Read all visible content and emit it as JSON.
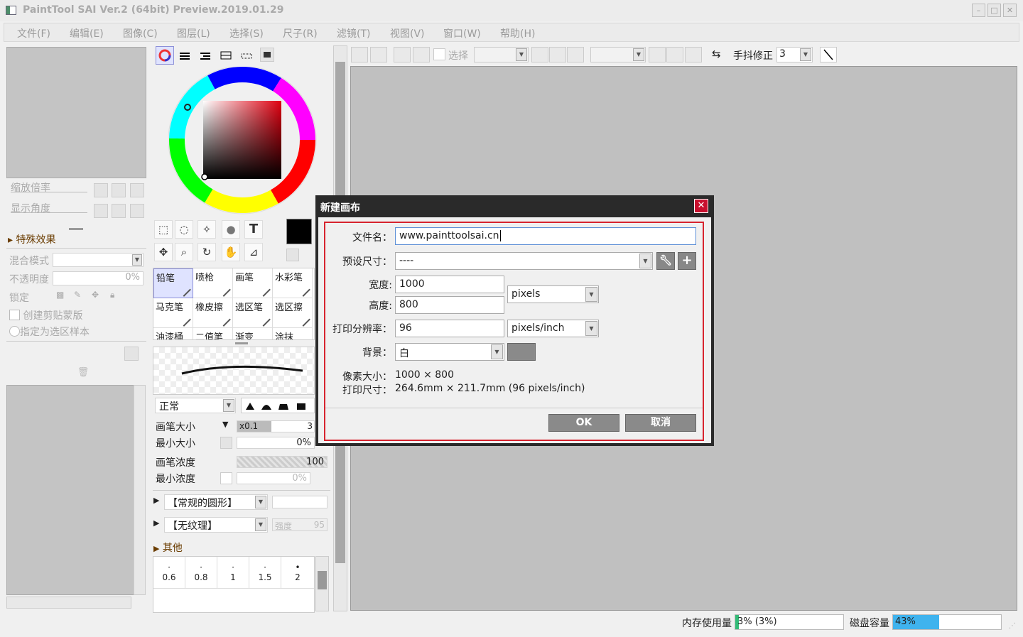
{
  "window": {
    "title": "PaintTool SAI Ver.2 (64bit) Preview.2019.01.29",
    "minimize_glyph": "–",
    "maximize_glyph": "□",
    "close_glyph": "✕"
  },
  "menu": [
    "文件(F)",
    "编辑(E)",
    "图像(C)",
    "图层(L)",
    "选择(S)",
    "尺子(R)",
    "滤镜(T)",
    "视图(V)",
    "窗口(W)",
    "帮助(H)"
  ],
  "navigator": {
    "zoom_label": "缩放倍率",
    "rotate_label": "显示角度"
  },
  "layer_panel": {
    "effects_label": "特殊效果",
    "blend_label": "混合模式",
    "opacity_label": "不透明度",
    "opacity_value": "0%",
    "lock_label": "锁定",
    "clip_label": "创建剪贴蒙版",
    "sample_label": "指定为选区样本"
  },
  "toolbar": {
    "select_label": "选择",
    "stabilizer_label": "手抖修正",
    "stabilizer_value": "3"
  },
  "tools": {
    "text_glyph": "T",
    "move_glyph": "✥",
    "zoom_glyph": "⌕",
    "rotate_glyph": "↻",
    "hand_glyph": "✋",
    "dropper_glyph": "⊿",
    "select_glyph": "⬚",
    "lasso_glyph": "◌",
    "wand_glyph": "✧",
    "fill_glyph": "●"
  },
  "brushes": [
    "铅笔",
    "喷枪",
    "画笔",
    "水彩笔",
    "马克笔",
    "橡皮擦",
    "选区笔",
    "选区擦",
    "油漆桶",
    "二值笔",
    "渐变",
    "涂抹"
  ],
  "brush_settings": {
    "mode": "正常",
    "size_label": "画笔大小",
    "size_mult": "x0.1",
    "size_value": "3",
    "min_size_label": "最小大小",
    "min_size_value": "0%",
    "density_label": "画笔浓度",
    "density_value": "100",
    "min_density_label": "最小浓度",
    "min_density_value": "0%",
    "shape": "【常规的圆形】",
    "texture": "【无纹理】",
    "strength_label": "强度",
    "strength_value": "95",
    "other_label": "其他",
    "sizes_row1": [
      "0.6",
      "0.8",
      "1",
      "1.5",
      "2"
    ]
  },
  "dialog": {
    "title": "新建画布",
    "close_glyph": "✕",
    "filename_label": "文件名：",
    "filename_value": "www.painttoolsai.cn",
    "preset_label": "预设尺寸：",
    "preset_value": "----",
    "width_label": "宽度:",
    "width_value": "1000",
    "height_label": "高度:",
    "height_value": "800",
    "unit_value": "pixels",
    "dpi_label": "打印分辨率：",
    "dpi_value": "96",
    "dpi_unit": "pixels/inch",
    "bg_label": "背景：",
    "bg_value": "白",
    "pixel_size_label": "像素大小：",
    "pixel_size_value": "1000 × 800",
    "print_size_label": "打印尺寸：",
    "print_size_value": "264.6mm × 211.7mm (96 pixels/inch)",
    "ok_label": "OK",
    "cancel_label": "取消"
  },
  "status": {
    "memory_label": "内存使用量",
    "memory_value": "3% (3%)",
    "memory_fraction": 0.03,
    "disk_label": "磁盘容量",
    "disk_value": "43%",
    "disk_fraction": 0.43
  },
  "colors": {
    "accent_red": "#d7232e",
    "close_red": "#c8102e",
    "disk_fill": "#3fb3ee",
    "memory_fill": "#33bb77"
  }
}
